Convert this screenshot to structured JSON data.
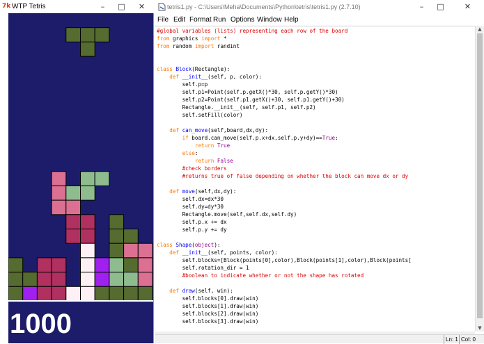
{
  "tetris": {
    "title": "WTP Tetris",
    "icon": "python-tetris-icon",
    "score": "1000",
    "colors": {
      "background": "#1c1c6b",
      "olive": "#556b2f",
      "light_green": "#8fbc8f",
      "pink": "#db7093",
      "crimson": "#b03060",
      "lavender_blush": "#fff0f5",
      "purple": "#a020f0"
    }
  },
  "editor": {
    "title": "tetris1.py - C:\\Users\\Meha\\Documents\\Python\\tetris\\tetris1.py (2.7.10)",
    "menu": [
      "File",
      "Edit",
      "Format",
      "Run",
      "Options",
      "Window",
      "Help"
    ],
    "status": {
      "line": "Ln: 1",
      "col": "Col: 0"
    },
    "code": [
      [
        [
          "cm",
          "#global variables (lists) representing each row of the board"
        ]
      ],
      [
        [
          "kw",
          "from"
        ],
        [
          "",
          " graphics "
        ],
        [
          "kw",
          "import"
        ],
        [
          "",
          " *"
        ]
      ],
      [
        [
          "kw",
          "from"
        ],
        [
          "",
          " random "
        ],
        [
          "kw",
          "import"
        ],
        [
          "",
          " randint"
        ]
      ],
      [],
      [],
      [
        [
          "kw",
          "class"
        ],
        [
          "",
          " "
        ],
        [
          "df",
          "Block"
        ],
        [
          "",
          "(Rectangle):"
        ]
      ],
      [
        [
          "",
          "    "
        ],
        [
          "kw",
          "def"
        ],
        [
          "",
          " "
        ],
        [
          "df",
          "__init__"
        ],
        [
          "",
          "(self, p, color):"
        ]
      ],
      [
        [
          "",
          "        self.p=p"
        ]
      ],
      [
        [
          "",
          "        self.p1=Point(self.p.getX()*30, self.p.getY()*30)"
        ]
      ],
      [
        [
          "",
          "        self.p2=Point(self.p1.getX()+30, self.p1.getY()+30)"
        ]
      ],
      [
        [
          "",
          "        Rectangle.__init__(self, self.p1, self.p2)"
        ]
      ],
      [
        [
          "",
          "        self.setFill(color)"
        ]
      ],
      [],
      [
        [
          "",
          "    "
        ],
        [
          "kw",
          "def"
        ],
        [
          "",
          " "
        ],
        [
          "df",
          "can_move"
        ],
        [
          "",
          "(self,board,dx,dy):"
        ]
      ],
      [
        [
          "",
          "        "
        ],
        [
          "kw",
          "if"
        ],
        [
          "",
          " board.can_move(self.p.x+dx,self.p.y+dy)=="
        ],
        [
          "bi",
          "True"
        ],
        [
          "",
          ":"
        ]
      ],
      [
        [
          "",
          "            "
        ],
        [
          "kw",
          "return"
        ],
        [
          "",
          " "
        ],
        [
          "bi",
          "True"
        ]
      ],
      [
        [
          "",
          "        "
        ],
        [
          "kw",
          "else"
        ],
        [
          "",
          ":"
        ]
      ],
      [
        [
          "",
          "            "
        ],
        [
          "kw",
          "return"
        ],
        [
          "",
          " "
        ],
        [
          "bi",
          "False"
        ]
      ],
      [
        [
          "",
          "        "
        ],
        [
          "cm",
          "#check borders"
        ]
      ],
      [
        [
          "",
          "        "
        ],
        [
          "cm",
          "#returns true of false depending on whether the block can move dx or dy"
        ]
      ],
      [],
      [
        [
          "",
          "    "
        ],
        [
          "kw",
          "def"
        ],
        [
          "",
          " "
        ],
        [
          "df",
          "move"
        ],
        [
          "",
          "(self,dx,dy):"
        ]
      ],
      [
        [
          "",
          "        self.dx=dx*30"
        ]
      ],
      [
        [
          "",
          "        self.dy=dy*30"
        ]
      ],
      [
        [
          "",
          "        Rectangle.move(self,self.dx,self.dy)"
        ]
      ],
      [
        [
          "",
          "        self.p.x += dx"
        ]
      ],
      [
        [
          "",
          "        self.p.y += dy"
        ]
      ],
      [],
      [
        [
          "kw",
          "class"
        ],
        [
          "",
          " "
        ],
        [
          "df",
          "Shape"
        ],
        [
          "",
          "("
        ],
        [
          "bi",
          "object"
        ],
        [
          "",
          "):"
        ]
      ],
      [
        [
          "",
          "    "
        ],
        [
          "kw",
          "def"
        ],
        [
          "",
          " "
        ],
        [
          "df",
          "__init__"
        ],
        [
          "",
          "(self, points, color):"
        ]
      ],
      [
        [
          "",
          "        self.blocks=[Block(points[0],color),Block(points[1],color),Block(points["
        ]
      ],
      [
        [
          "",
          "        self.rotation_dir = 1"
        ]
      ],
      [
        [
          "",
          "        "
        ],
        [
          "cm",
          "#boolean to indicate whether or not the shape has rotated"
        ]
      ],
      [],
      [
        [
          "",
          "    "
        ],
        [
          "kw",
          "def"
        ],
        [
          "",
          " "
        ],
        [
          "df",
          "draw"
        ],
        [
          "",
          "(self, win):"
        ]
      ],
      [
        [
          "",
          "        self.blocks[0].draw(win)"
        ]
      ],
      [
        [
          "",
          "        self.blocks[1].draw(win)"
        ]
      ],
      [
        [
          "",
          "        self.blocks[2].draw(win)"
        ]
      ],
      [
        [
          "",
          "        self.blocks[3].draw(win)"
        ]
      ]
    ]
  }
}
